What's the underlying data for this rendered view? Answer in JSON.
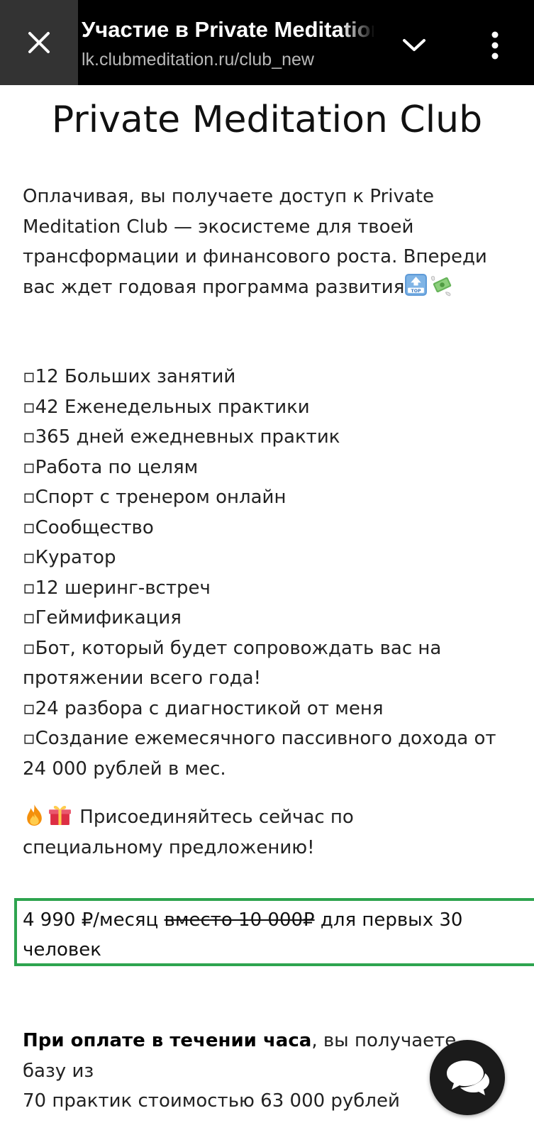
{
  "browser": {
    "tab_title": "Участие в Private Meditation",
    "url": "lk.clubmeditation.ru/club_new",
    "icons": {
      "close": "close-icon",
      "expand": "chevron-down-icon",
      "menu": "more-vertical-icon"
    }
  },
  "page": {
    "title": "Private Meditation Club",
    "intro": "Оплачивая, вы получаете доступ к Private Meditation Club — экосистеме для твоей трансформации и финансового роста. Впереди вас ждет годовая программа развития",
    "intro_emojis": [
      "top-arrow-emoji",
      "money-with-wings-emoji"
    ],
    "features": [
      "▫12 Больших занятий",
      "▫42 Еженедельных практики",
      "▫365 дней ежедневных  практик",
      "▫Работа по целям",
      "▫Спорт с тренером онлайн",
      "▫Сообщество",
      "▫Куратор",
      "▫12 шеринг-встреч",
      "▫Геймификация",
      "▫Бот, который будет сопровождать вас на протяжении всего года!",
      "▫24 разбора с диагностикой от меня",
      "▫Создание ежемесячного пассивного дохода от 24 000 рублей в мес."
    ],
    "offer_emojis": [
      "fire-emoji",
      "gift-emoji"
    ],
    "offer_text": "Присоединяйтесь сейчас по специальному предложению!",
    "price": {
      "current": "4 990 ₽/месяц",
      "old": "вместо 10 000₽",
      "suffix": "для первых 30 человек"
    },
    "bonus": {
      "bold": "При оплате в течении часа",
      "text": ", вы получаете базу из",
      "line2": "70 практик стоимостью 63 000 рублей"
    }
  },
  "colors": {
    "topbar": "#000000",
    "price_border": "#2ea44f",
    "chat_button": "#1b1b1b"
  },
  "chat_button_icon": "chat-bubbles-icon"
}
